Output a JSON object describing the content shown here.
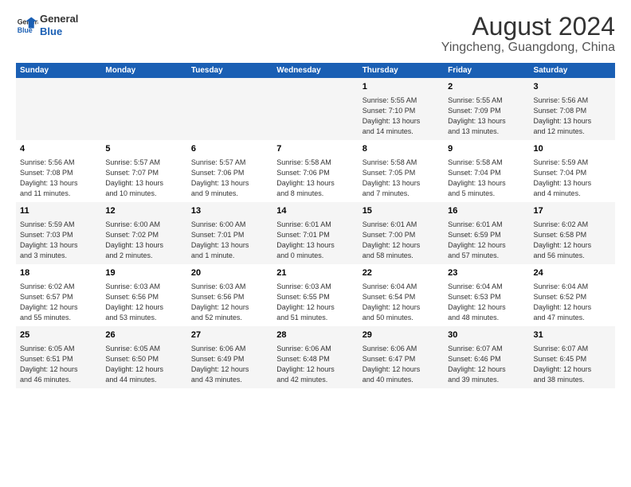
{
  "logo": {
    "line1": "General",
    "line2": "Blue"
  },
  "title": "August 2024",
  "subtitle": "Yingcheng, Guangdong, China",
  "days_of_week": [
    "Sunday",
    "Monday",
    "Tuesday",
    "Wednesday",
    "Thursday",
    "Friday",
    "Saturday"
  ],
  "weeks": [
    [
      {
        "num": "",
        "info": ""
      },
      {
        "num": "",
        "info": ""
      },
      {
        "num": "",
        "info": ""
      },
      {
        "num": "",
        "info": ""
      },
      {
        "num": "1",
        "info": "Sunrise: 5:55 AM\nSunset: 7:10 PM\nDaylight: 13 hours\nand 14 minutes."
      },
      {
        "num": "2",
        "info": "Sunrise: 5:55 AM\nSunset: 7:09 PM\nDaylight: 13 hours\nand 13 minutes."
      },
      {
        "num": "3",
        "info": "Sunrise: 5:56 AM\nSunset: 7:08 PM\nDaylight: 13 hours\nand 12 minutes."
      }
    ],
    [
      {
        "num": "4",
        "info": "Sunrise: 5:56 AM\nSunset: 7:08 PM\nDaylight: 13 hours\nand 11 minutes."
      },
      {
        "num": "5",
        "info": "Sunrise: 5:57 AM\nSunset: 7:07 PM\nDaylight: 13 hours\nand 10 minutes."
      },
      {
        "num": "6",
        "info": "Sunrise: 5:57 AM\nSunset: 7:06 PM\nDaylight: 13 hours\nand 9 minutes."
      },
      {
        "num": "7",
        "info": "Sunrise: 5:58 AM\nSunset: 7:06 PM\nDaylight: 13 hours\nand 8 minutes."
      },
      {
        "num": "8",
        "info": "Sunrise: 5:58 AM\nSunset: 7:05 PM\nDaylight: 13 hours\nand 7 minutes."
      },
      {
        "num": "9",
        "info": "Sunrise: 5:58 AM\nSunset: 7:04 PM\nDaylight: 13 hours\nand 5 minutes."
      },
      {
        "num": "10",
        "info": "Sunrise: 5:59 AM\nSunset: 7:04 PM\nDaylight: 13 hours\nand 4 minutes."
      }
    ],
    [
      {
        "num": "11",
        "info": "Sunrise: 5:59 AM\nSunset: 7:03 PM\nDaylight: 13 hours\nand 3 minutes."
      },
      {
        "num": "12",
        "info": "Sunrise: 6:00 AM\nSunset: 7:02 PM\nDaylight: 13 hours\nand 2 minutes."
      },
      {
        "num": "13",
        "info": "Sunrise: 6:00 AM\nSunset: 7:01 PM\nDaylight: 13 hours\nand 1 minute."
      },
      {
        "num": "14",
        "info": "Sunrise: 6:01 AM\nSunset: 7:01 PM\nDaylight: 13 hours\nand 0 minutes."
      },
      {
        "num": "15",
        "info": "Sunrise: 6:01 AM\nSunset: 7:00 PM\nDaylight: 12 hours\nand 58 minutes."
      },
      {
        "num": "16",
        "info": "Sunrise: 6:01 AM\nSunset: 6:59 PM\nDaylight: 12 hours\nand 57 minutes."
      },
      {
        "num": "17",
        "info": "Sunrise: 6:02 AM\nSunset: 6:58 PM\nDaylight: 12 hours\nand 56 minutes."
      }
    ],
    [
      {
        "num": "18",
        "info": "Sunrise: 6:02 AM\nSunset: 6:57 PM\nDaylight: 12 hours\nand 55 minutes."
      },
      {
        "num": "19",
        "info": "Sunrise: 6:03 AM\nSunset: 6:56 PM\nDaylight: 12 hours\nand 53 minutes."
      },
      {
        "num": "20",
        "info": "Sunrise: 6:03 AM\nSunset: 6:56 PM\nDaylight: 12 hours\nand 52 minutes."
      },
      {
        "num": "21",
        "info": "Sunrise: 6:03 AM\nSunset: 6:55 PM\nDaylight: 12 hours\nand 51 minutes."
      },
      {
        "num": "22",
        "info": "Sunrise: 6:04 AM\nSunset: 6:54 PM\nDaylight: 12 hours\nand 50 minutes."
      },
      {
        "num": "23",
        "info": "Sunrise: 6:04 AM\nSunset: 6:53 PM\nDaylight: 12 hours\nand 48 minutes."
      },
      {
        "num": "24",
        "info": "Sunrise: 6:04 AM\nSunset: 6:52 PM\nDaylight: 12 hours\nand 47 minutes."
      }
    ],
    [
      {
        "num": "25",
        "info": "Sunrise: 6:05 AM\nSunset: 6:51 PM\nDaylight: 12 hours\nand 46 minutes."
      },
      {
        "num": "26",
        "info": "Sunrise: 6:05 AM\nSunset: 6:50 PM\nDaylight: 12 hours\nand 44 minutes."
      },
      {
        "num": "27",
        "info": "Sunrise: 6:06 AM\nSunset: 6:49 PM\nDaylight: 12 hours\nand 43 minutes."
      },
      {
        "num": "28",
        "info": "Sunrise: 6:06 AM\nSunset: 6:48 PM\nDaylight: 12 hours\nand 42 minutes."
      },
      {
        "num": "29",
        "info": "Sunrise: 6:06 AM\nSunset: 6:47 PM\nDaylight: 12 hours\nand 40 minutes."
      },
      {
        "num": "30",
        "info": "Sunrise: 6:07 AM\nSunset: 6:46 PM\nDaylight: 12 hours\nand 39 minutes."
      },
      {
        "num": "31",
        "info": "Sunrise: 6:07 AM\nSunset: 6:45 PM\nDaylight: 12 hours\nand 38 minutes."
      }
    ]
  ]
}
